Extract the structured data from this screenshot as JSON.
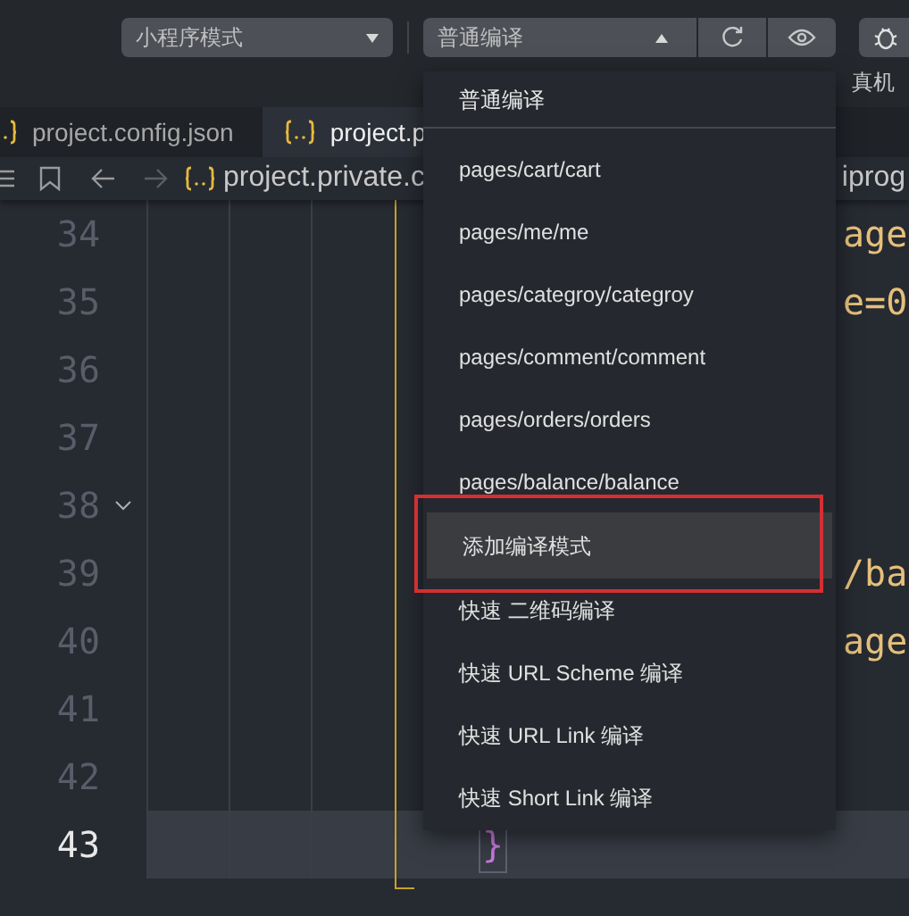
{
  "toolbar": {
    "mode_select": "小程序模式",
    "compile_select": "普通编译",
    "debug_label": "真机"
  },
  "tabs": [
    {
      "label": "project.config.json",
      "selected": false
    },
    {
      "label": "project.p",
      "selected": true
    }
  ],
  "breadcrumb": {
    "path": "project.private.c",
    "trailing": "iprog"
  },
  "editor": {
    "lines": [
      {
        "number": "34",
        "text": "age",
        "current": false,
        "foldable": false
      },
      {
        "number": "35",
        "text": "e=0",
        "current": false,
        "foldable": false
      },
      {
        "number": "36",
        "current": false,
        "foldable": false
      },
      {
        "number": "37",
        "current": false,
        "foldable": false
      },
      {
        "number": "38",
        "current": false,
        "foldable": true
      },
      {
        "number": "39",
        "text": "/ba",
        "current": false,
        "foldable": false
      },
      {
        "number": "40",
        "text": "age",
        "current": false,
        "foldable": false
      },
      {
        "number": "41",
        "current": false,
        "foldable": false
      },
      {
        "number": "42",
        "current": false,
        "foldable": false
      },
      {
        "number": "43",
        "brace": "}",
        "current": true,
        "foldable": false
      }
    ]
  },
  "compile_menu": {
    "header": "普通编译",
    "items": [
      {
        "label": "pages/cart/cart",
        "hovered": false,
        "highlighted": false
      },
      {
        "label": "pages/me/me",
        "hovered": false,
        "highlighted": false
      },
      {
        "label": "pages/categroy/categroy",
        "hovered": false,
        "highlighted": false
      },
      {
        "label": "pages/comment/comment",
        "hovered": false,
        "highlighted": false
      },
      {
        "label": "pages/orders/orders",
        "hovered": false,
        "highlighted": false
      },
      {
        "label": "pages/balance/balance",
        "hovered": false,
        "highlighted": false
      },
      {
        "label": "添加编译模式",
        "hovered": true,
        "highlighted": true
      },
      {
        "label": "快速 二维码编译",
        "hovered": false,
        "highlighted": false
      },
      {
        "label": "快速 URL Scheme 编译",
        "hovered": false,
        "highlighted": false
      },
      {
        "label": "快速 URL Link 编译",
        "hovered": false,
        "highlighted": false
      },
      {
        "label": "快速 Short Link 编译",
        "hovered": false,
        "highlighted": false
      }
    ]
  }
}
